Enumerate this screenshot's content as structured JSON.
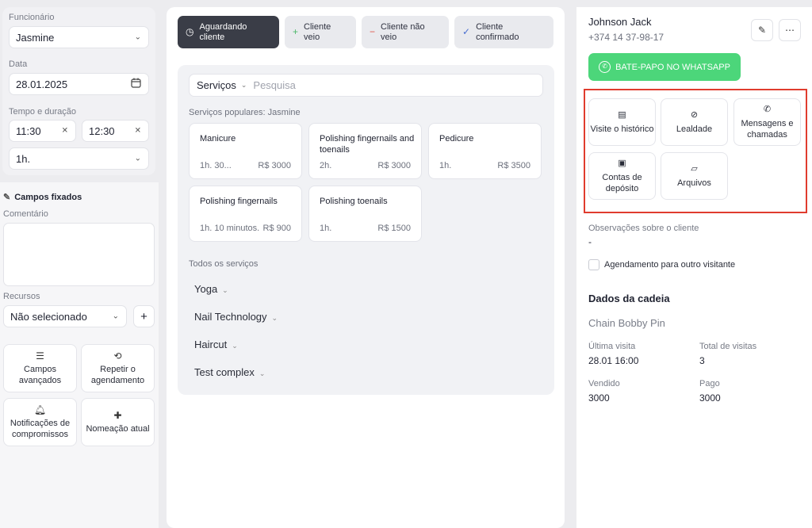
{
  "left": {
    "employee_label": "Funcionário",
    "employee_value": "Jasmine",
    "date_label": "Data",
    "date_value": "28.01.2025",
    "time_label": "Tempo e duração",
    "start_time": "11:30",
    "end_time": "12:30",
    "duration": "1h.",
    "fixed_fields": "Campos fixados",
    "comment_label": "Comentário",
    "resources_label": "Recursos",
    "resources_value": "Não selecionado",
    "tiles": [
      {
        "label": "Campos avançados",
        "icon": "list-icon"
      },
      {
        "label": "Repetir o agendamento",
        "icon": "repeat-icon"
      },
      {
        "label": "Notificações de compromissos",
        "icon": "bell-icon"
      },
      {
        "label": "Nomeação atual",
        "icon": "plus-cross-icon"
      }
    ]
  },
  "status": [
    {
      "label": "Aguardando cliente",
      "symbol": "◷"
    },
    {
      "label": "Cliente veio",
      "symbol": "+"
    },
    {
      "label": "Cliente não veio",
      "symbol": "−"
    },
    {
      "label": "Cliente confirmado",
      "symbol": "✓"
    }
  ],
  "services": {
    "dropdown": "Serviços",
    "search_placeholder": "Pesquisa",
    "popular_heading": "Serviços populares: Jasmine",
    "cards": [
      {
        "name": "Manicure",
        "duration": "1h. 30...",
        "price": "R$ 3000"
      },
      {
        "name": "Polishing fingernails and toenails",
        "duration": "2h.",
        "price": "R$ 3000"
      },
      {
        "name": "Pedicure",
        "duration": "1h.",
        "price": "R$ 3500"
      },
      {
        "name": "Polishing fingernails",
        "duration": "1h. 10 minutos.",
        "price": "R$ 900"
      },
      {
        "name": "Polishing toenails",
        "duration": "1h.",
        "price": "R$ 1500"
      }
    ],
    "all_heading": "Todos os serviços",
    "categories": [
      "Yoga",
      "Nail Technology",
      "Haircut",
      "Test complex"
    ]
  },
  "client": {
    "name": "Johnson Jack",
    "phone": "+374 14 37-98-17",
    "whatsapp": "BATE-PAPO NO WHATSAPP",
    "tiles": [
      {
        "label": "Visite o histórico",
        "icon": "history-icon"
      },
      {
        "label": "Lealdade",
        "icon": "loyalty-icon"
      },
      {
        "label": "Mensagens e chamadas",
        "icon": "chat-icon"
      },
      {
        "label": "Contas de depósito",
        "icon": "wallet-icon"
      },
      {
        "label": "Arquivos",
        "icon": "folder-icon"
      }
    ],
    "notes_label": "Observações sobre o cliente",
    "notes_value": "-",
    "other_visitor": "Agendamento para outro visitante",
    "chain_heading": "Dados da cadeia",
    "chain_name": "Chain Bobby Pin",
    "last_visit_label": "Última visita",
    "last_visit_value": "28.01 16:00",
    "total_visits_label": "Total de visitas",
    "total_visits_value": "3",
    "sold_label": "Vendido",
    "sold_value": "3000",
    "paid_label": "Pago",
    "paid_value": "3000"
  },
  "colors": {
    "accent_green": "#4cd67a",
    "highlight_red": "#e03c2e",
    "dark_status": "#3a3d47"
  }
}
